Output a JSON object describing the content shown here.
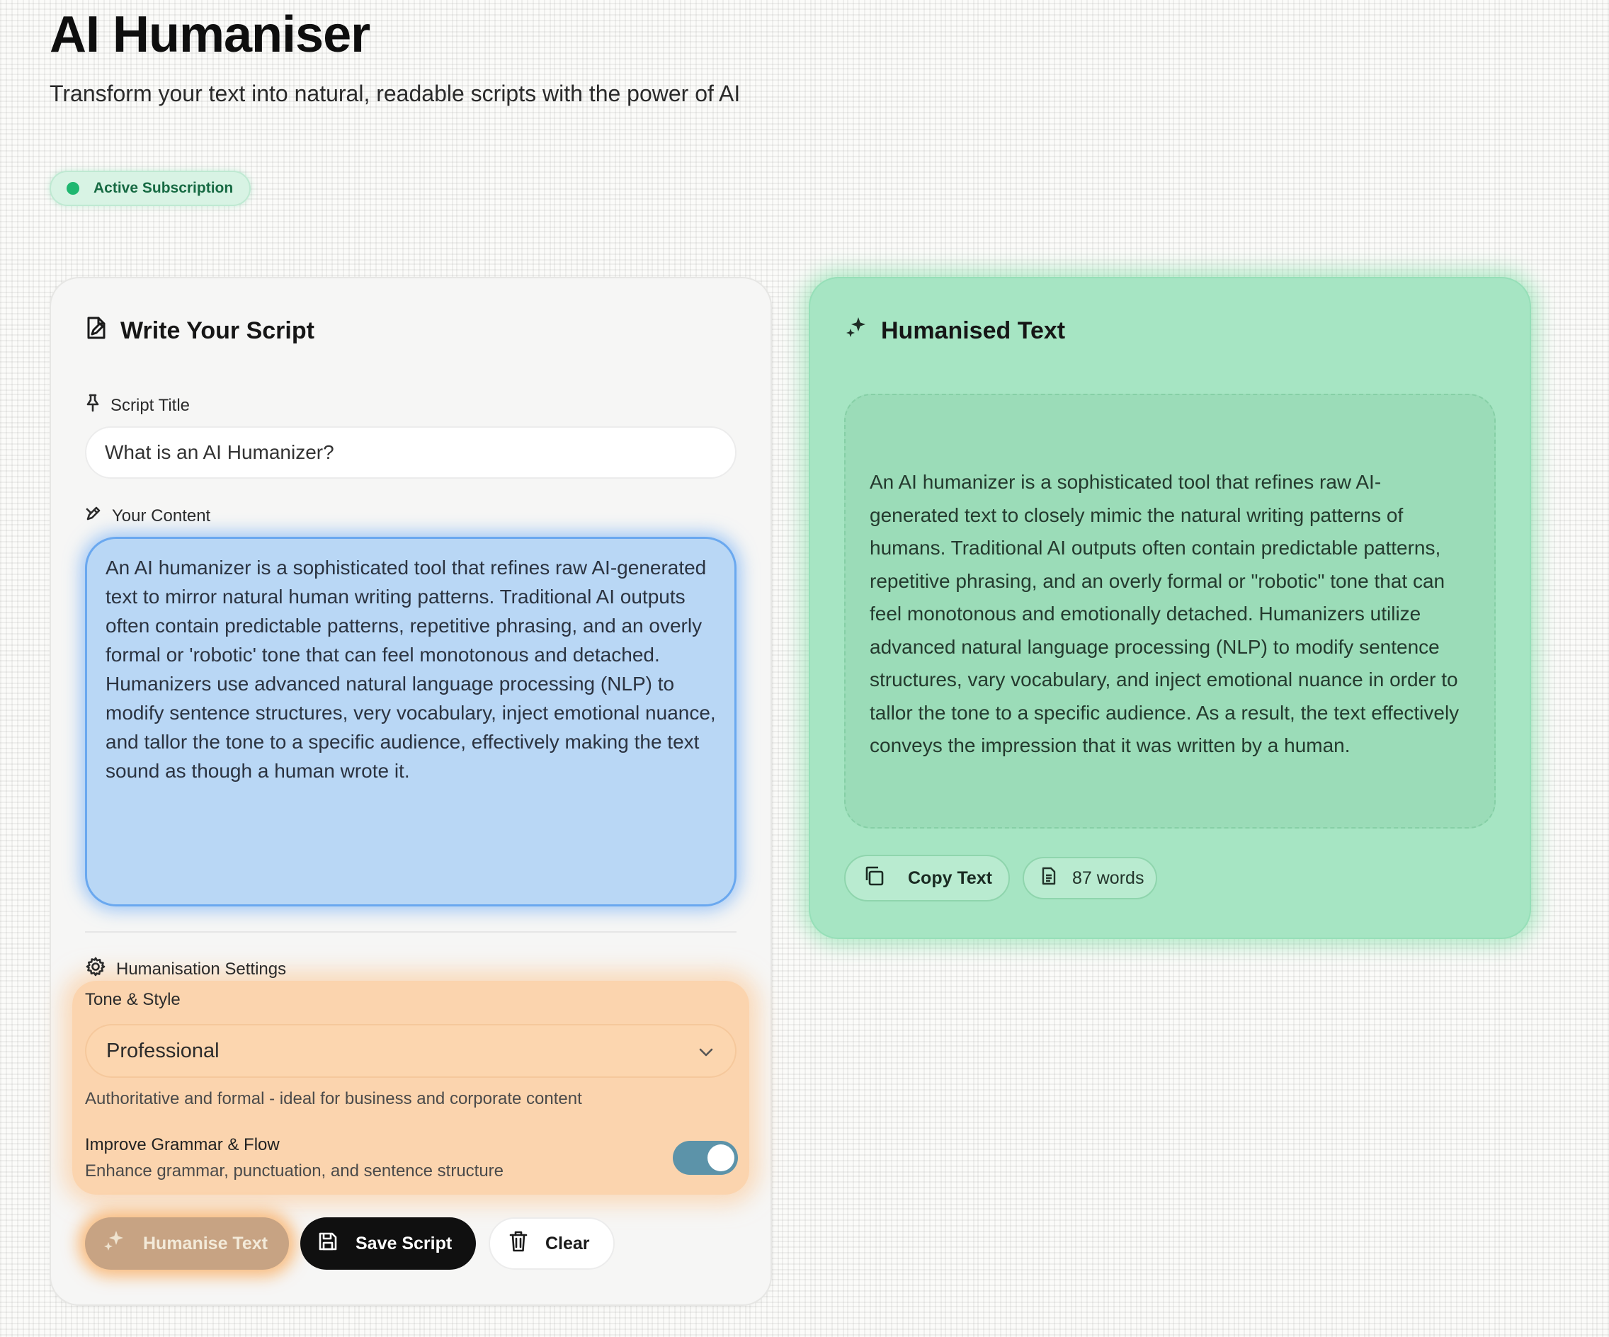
{
  "header": {
    "title": "AI Humaniser",
    "subtitle": "Transform your text into natural, readable scripts with the power of AI"
  },
  "subscription_badge": {
    "label": "Active Subscription",
    "color": "#1fb770"
  },
  "editor": {
    "heading": "Write Your Script",
    "title_label": "Script Title",
    "title_value": "What is an AI Humanizer?",
    "content_label": "Your Content",
    "content_value": "An AI humanizer is a sophisticated tool that refines raw AI-generated text to mirror natural human writing patterns. Traditional AI outputs often contain predictable patterns, repetitive phrasing, and an overly formal or 'robotic' tone that can feel monotonous and detached. Humanizers use advanced natural language processing (NLP) to modify sentence structures, very vocabulary, inject emotional nuance, and tallor the tone to a specific audience, effectively making the text sound as though a human wrote it."
  },
  "settings": {
    "heading": "Humanisation Settings",
    "tone_label": "Tone & Style",
    "tone_value": "Professional",
    "tone_description": "Authoritative and formal - ideal for business and corporate content",
    "grammar_title": "Improve Grammar & Flow",
    "grammar_description": "Enhance grammar, punctuation, and sentence structure",
    "grammar_enabled": true
  },
  "actions": {
    "humanise_label": "Humanise Text",
    "save_label": "Save Script",
    "clear_label": "Clear"
  },
  "output": {
    "heading": "Humanised Text",
    "text": "An AI humanizer is a sophisticated tool that refines raw AI-generated text to closely mimic the natural writing patterns of humans. Traditional AI outputs often contain predictable patterns, repetitive phrasing, and an overly formal or \"robotic\" tone that can feel monotonous and emotionally detached. Humanizers utilize advanced natural language processing (NLP) to modify sentence structures, vary vocabulary, and inject emotional nuance in order to tallor the tone to a specific audience. As a result, the text effectively conveys the impression that it was written by a human.",
    "copy_label": "Copy Text",
    "word_count": "87 words"
  },
  "colors": {
    "input_accent": "#6aa8ef",
    "output_accent": "#a6e5c3",
    "settings_accent": "#fcc896"
  },
  "icons": [
    "file-edit-icon",
    "pin-icon",
    "pen-icon",
    "sparkles-icon",
    "gear-icon",
    "chevron-down-icon",
    "save-icon",
    "trash-icon",
    "copy-icon",
    "document-icon"
  ]
}
